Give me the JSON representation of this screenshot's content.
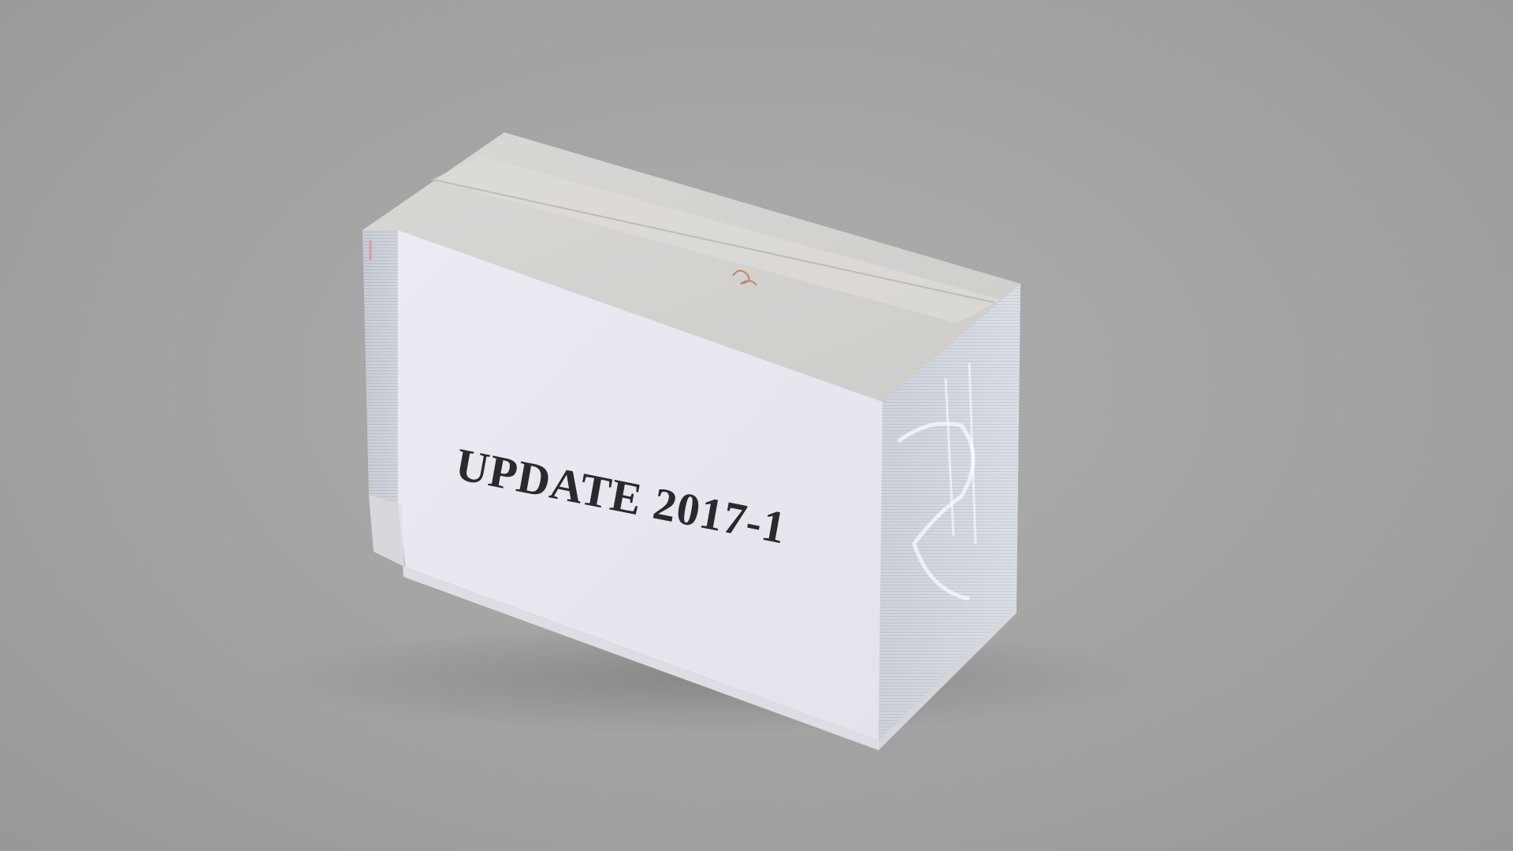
{
  "photo": {
    "subject": "stack-of-cards-with-paper-label",
    "background_color": "#a4a5a4"
  },
  "label": {
    "text": "UPDATE 2017-1"
  }
}
